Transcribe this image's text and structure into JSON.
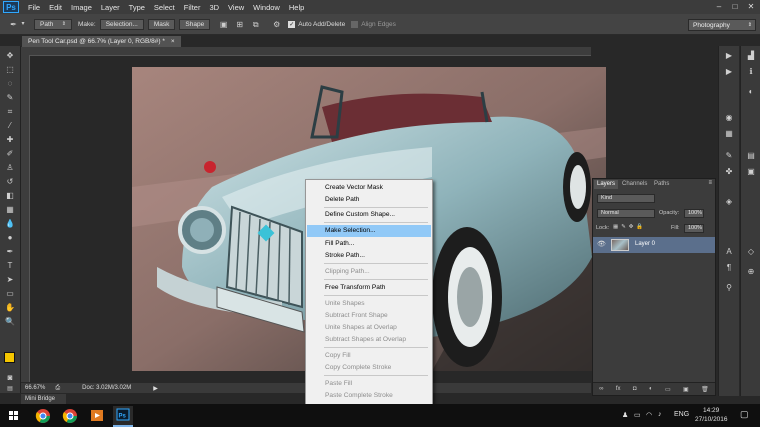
{
  "app": {
    "logo": "Ps"
  },
  "menubar": {
    "items": [
      "File",
      "Edit",
      "Image",
      "Layer",
      "Type",
      "Select",
      "Filter",
      "3D",
      "View",
      "Window",
      "Help"
    ]
  },
  "options_bar": {
    "mode_value": "Path",
    "make_label": "Make:",
    "selection_label": "Selection...",
    "mask_label": "Mask",
    "shape_label": "Shape",
    "auto_add_delete": "Auto Add/Delete",
    "align_edges": "Align Edges",
    "workspace": "Photography"
  },
  "document": {
    "tab_title": "Pen Tool Car.psd @ 66.7% (Layer 0, RGB/8#) *"
  },
  "status_bar": {
    "zoom": "66.67%",
    "doc_info": "Doc: 3.02M/3.02M"
  },
  "mini_bridge": {
    "label": "Mini Bridge"
  },
  "layers_panel": {
    "tabs": [
      "Layers",
      "Channels",
      "Paths"
    ],
    "kind": "Kind",
    "blend_mode": "Normal",
    "opacity_label": "Opacity:",
    "opacity_value": "100%",
    "lock_label": "Lock:",
    "fill_label": "Fill:",
    "fill_value": "100%",
    "layer_name": "Layer 0"
  },
  "context_menu": {
    "items": [
      {
        "label": "Create Vector Mask",
        "enabled": true
      },
      {
        "label": "Delete Path",
        "enabled": true
      },
      {
        "label": "Define Custom Shape...",
        "enabled": true
      },
      {
        "label": "Make Selection...",
        "enabled": true,
        "highlighted": true
      },
      {
        "label": "Fill Path...",
        "enabled": true
      },
      {
        "label": "Stroke Path...",
        "enabled": true
      },
      {
        "label": "Clipping Path...",
        "enabled": false
      },
      {
        "label": "Free Transform Path",
        "enabled": true
      },
      {
        "label": "Unite Shapes",
        "enabled": false
      },
      {
        "label": "Subtract Front Shape",
        "enabled": false
      },
      {
        "label": "Unite Shapes at Overlap",
        "enabled": false
      },
      {
        "label": "Subtract Shapes at Overlap",
        "enabled": false
      },
      {
        "label": "Copy Fill",
        "enabled": false
      },
      {
        "label": "Copy Complete Stroke",
        "enabled": false
      },
      {
        "label": "Paste Fill",
        "enabled": false
      },
      {
        "label": "Paste Complete Stroke",
        "enabled": false
      }
    ]
  },
  "taskbar": {
    "language": "ENG",
    "time": "14:29",
    "date": "27/10/2016"
  }
}
